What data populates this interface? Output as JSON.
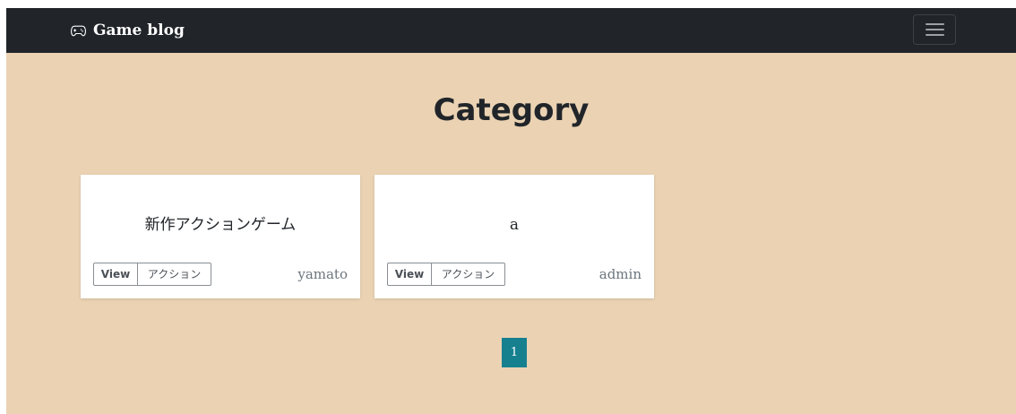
{
  "navbar": {
    "brand_icon": "gamepad-icon",
    "brand_label": "Game blog",
    "toggler_icon": "hamburger-menu-icon"
  },
  "page": {
    "title": "Category"
  },
  "cards": [
    {
      "title": "新作アクションゲーム",
      "view_label": "View",
      "category_label": "アクション",
      "author": "yamato"
    },
    {
      "title": "a",
      "view_label": "View",
      "category_label": "アクション",
      "author": "admin"
    }
  ],
  "pagination": {
    "current_page": "1"
  },
  "colors": {
    "navbar_bg": "#212529",
    "page_bg": "#ead2b3",
    "pagination_active": "#16808f"
  }
}
